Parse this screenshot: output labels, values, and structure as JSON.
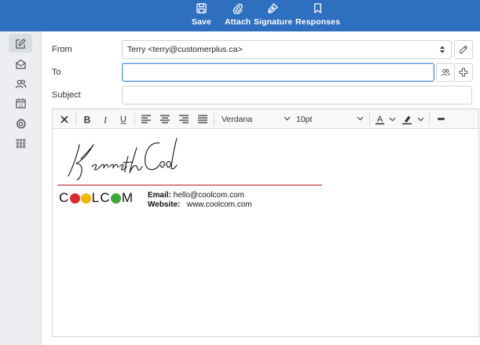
{
  "toolbar": {
    "save_label": "Save",
    "attach_label": "Attach",
    "signature_label": "Signature",
    "responses_label": "Responses",
    "bg_color": "#2f6fbf"
  },
  "sidebar": {
    "items": [
      {
        "icon": "compose-icon",
        "active": true
      },
      {
        "icon": "mail-icon",
        "active": false
      },
      {
        "icon": "contacts-icon",
        "active": false
      },
      {
        "icon": "calendar-icon",
        "active": false
      },
      {
        "icon": "settings-icon",
        "active": false
      },
      {
        "icon": "apps-grid-icon",
        "active": false
      }
    ]
  },
  "compose": {
    "from_label": "From",
    "from_value": "Terry <terry@customerplus.ca>",
    "to_label": "To",
    "to_value": "",
    "subject_label": "Subject",
    "subject_value": ""
  },
  "editor": {
    "font_family": "Verdana",
    "font_size": "10pt",
    "more_label": "•••"
  },
  "signature": {
    "handwritten_name": "Kenneth Cool",
    "logo_text_parts": [
      "C",
      "",
      "",
      "LC",
      "",
      "M"
    ],
    "logo_word": "COOLCOM",
    "email_label": "Email:",
    "email_value": "hello@coolcom.com",
    "website_label": "Website:",
    "website_value": "www.coolcom.com",
    "line_color": "#b52020",
    "dot_colors": [
      "#e02a2a",
      "#f5b400",
      "#f5b400",
      "#3aa83a"
    ]
  }
}
